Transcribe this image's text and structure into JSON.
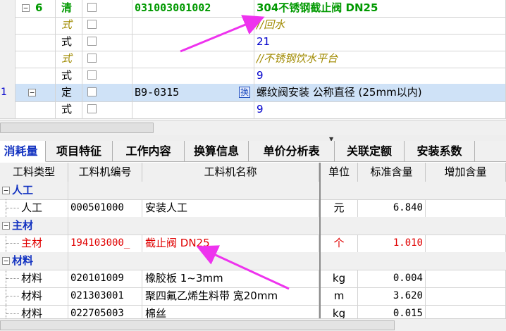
{
  "top_rows": [
    {
      "rownum": "",
      "tree": "⊟",
      "seq": "6",
      "type": "清",
      "code": "031003001002",
      "name": "304不锈钢截止阀 DN25",
      "kind": "qing"
    },
    {
      "rownum": "",
      "tree": "",
      "seq": "",
      "type": "式",
      "code": "",
      "name": "//回水",
      "kind": "comment"
    },
    {
      "rownum": "",
      "tree": "",
      "seq": "",
      "type": "式",
      "code": "",
      "name": "21",
      "kind": "formula"
    },
    {
      "rownum": "",
      "tree": "",
      "seq": "",
      "type": "式",
      "code": "",
      "name": "//不锈钢饮水平台",
      "kind": "comment"
    },
    {
      "rownum": "",
      "tree": "",
      "seq": "",
      "type": "式",
      "code": "",
      "name": "9",
      "kind": "formula"
    },
    {
      "rownum": "1",
      "tree": "⊟",
      "seq": "",
      "type": "定",
      "code": "B9-0315",
      "badge": "换",
      "name": "螺纹阀安装 公称直径 (25mm以内)",
      "kind": "ding"
    },
    {
      "rownum": "",
      "tree": "",
      "seq": "",
      "type": "式",
      "code": "",
      "name": "9",
      "kind": "formula"
    }
  ],
  "tabs": [
    "消耗量",
    "项目特征",
    "工作内容",
    "换算信息",
    "单价分析表",
    "关联定额",
    "安装系数"
  ],
  "active_tab": "消耗量",
  "bottom_headers": [
    "工料类型",
    "工料机编号",
    "工料机名称",
    "单位",
    "标准含量",
    "增加含量"
  ],
  "bottom_rows": [
    {
      "group": true,
      "tree": "⊟",
      "label": "人工"
    },
    {
      "group": false,
      "type": "人工",
      "code": "000501000",
      "name": "安装人工",
      "unit": "元",
      "std": "6.840",
      "add": "",
      "red": false
    },
    {
      "group": true,
      "tree": "⊟",
      "label": "主材"
    },
    {
      "group": false,
      "type": "主材",
      "code": "194103000_",
      "name": "截止阀 DN25",
      "unit": "个",
      "std": "1.010",
      "add": "",
      "red": true
    },
    {
      "group": true,
      "tree": "⊟",
      "label": "材料"
    },
    {
      "group": false,
      "type": "材料",
      "code": "020101009",
      "name": "橡胶板 1~3mm",
      "unit": "kg",
      "std": "0.004",
      "add": "",
      "red": false
    },
    {
      "group": false,
      "type": "材料",
      "code": "021303001",
      "name": "聚四氟乙烯生料带 宽20mm",
      "unit": "m",
      "std": "3.620",
      "add": "",
      "red": false
    },
    {
      "group": false,
      "type": "材料",
      "code": "022705003",
      "name": "棉丝",
      "unit": "kg",
      "std": "0.015",
      "add": "",
      "red": false
    }
  ],
  "colors": {
    "arrow": "#ee33ee",
    "accent": "#1030c0",
    "selected_row": "#cfe2f7",
    "red": "#e00000",
    "green": "#009900"
  },
  "icons": {
    "collapse": "minus-box-icon",
    "splitter": "triangle-down-icon"
  }
}
